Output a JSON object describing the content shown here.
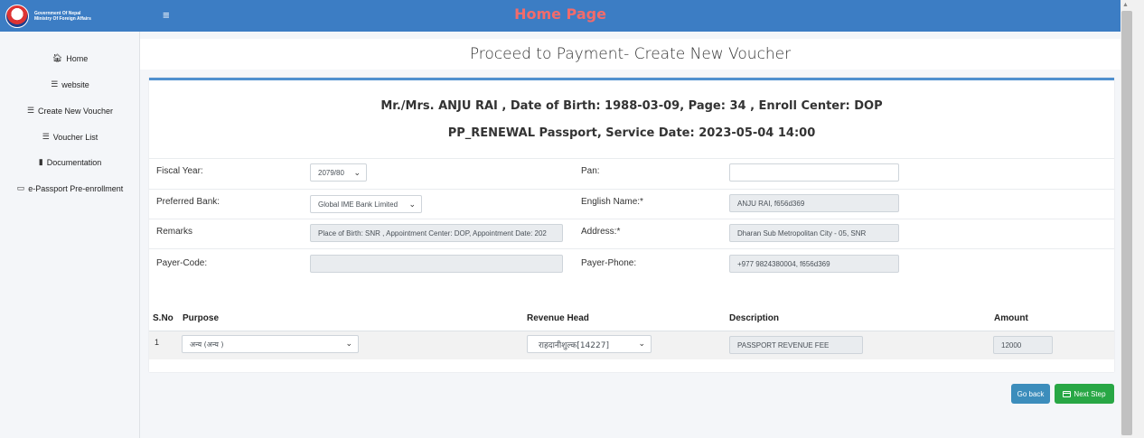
{
  "header": {
    "logo_text_line1": "Government Of Nepal",
    "logo_text_line2": "Ministry Of Foreign Affairs",
    "title": "Home Page",
    "menu_icon": "hamburger-icon"
  },
  "sidebar": {
    "items": [
      {
        "label": "Home",
        "icon": "house-icon"
      },
      {
        "label": "website",
        "icon": "list-icon"
      },
      {
        "label": "Create New Voucher",
        "icon": "list-icon"
      },
      {
        "label": "Voucher List",
        "icon": "list-icon"
      },
      {
        "label": "Documentation",
        "icon": "book-icon"
      },
      {
        "label": "e-Passport Pre-enrollment",
        "icon": "laptop-icon"
      }
    ]
  },
  "main": {
    "page_title": "Proceed to Payment- Create New Voucher",
    "info_line1": "Mr./Mrs. ANJU  RAI ,  Date of Birth: 1988-03-09, Page:  34 , Enroll Center: DOP",
    "info_line2": "PP_RENEWAL Passport, Service Date: 2023-05-04 14:00"
  },
  "form": {
    "fiscal_year_label": "Fiscal Year:",
    "fiscal_year_value": "2079/80",
    "pan_label": "Pan:",
    "pan_value": "",
    "preferred_bank_label": "Preferred Bank:",
    "preferred_bank_value": "Global IME Bank Limited",
    "english_name_label": "English Name:*",
    "english_name_value": "ANJU RAI, f656d369",
    "remarks_label": "Remarks",
    "remarks_value": "Place of Birth: SNR , Appointment Center: DOP, Appointment Date: 202",
    "address_label": "Address:*",
    "address_value": "Dharan Sub Metropolitan City - 05, SNR",
    "payer_code_label": "Payer-Code:",
    "payer_code_value": "",
    "payer_phone_label": "Payer-Phone:",
    "payer_phone_value": "+977 9824380004, f656d369"
  },
  "table": {
    "headers": [
      "S.No",
      "Purpose",
      "Revenue Head",
      "Description",
      "Amount"
    ],
    "rows": [
      {
        "sno": "1",
        "purpose": "अन्य (अन्य )",
        "revenue_head": "राहदानीशुल्क[14227]",
        "description": "PASSPORT REVENUE FEE",
        "amount": "12000"
      }
    ]
  },
  "actions": {
    "back_label": "Go back",
    "next_label": "Next Step"
  },
  "colors": {
    "header_bg": "#3c7dc4",
    "header_title": "#f26b6b",
    "card_top_border": "#4e8fce",
    "back_button": "#3c8dbc",
    "next_button": "#28a745"
  }
}
